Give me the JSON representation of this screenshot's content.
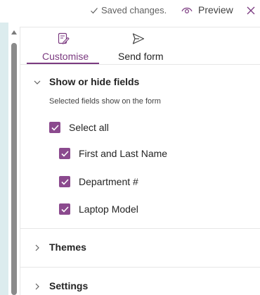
{
  "header": {
    "saved_status": "Saved changes.",
    "preview_label": "Preview"
  },
  "tabs": [
    {
      "label": "Customise",
      "selected": true
    },
    {
      "label": "Send form",
      "selected": false
    }
  ],
  "sections": {
    "fields": {
      "title": "Show or hide fields",
      "expanded": true,
      "hint": "Selected fields show on the form",
      "select_all": {
        "label": "Select all",
        "checked": true
      },
      "items": [
        {
          "label": "First and Last Name",
          "checked": true
        },
        {
          "label": "Department #",
          "checked": true
        },
        {
          "label": "Laptop Model",
          "checked": true
        }
      ]
    },
    "themes": {
      "title": "Themes",
      "expanded": false
    },
    "settings": {
      "title": "Settings",
      "expanded": false
    }
  },
  "colors": {
    "accent": "#7b3a80",
    "checkbox": "#8b4a8e",
    "left_strip": "#dcecee"
  }
}
